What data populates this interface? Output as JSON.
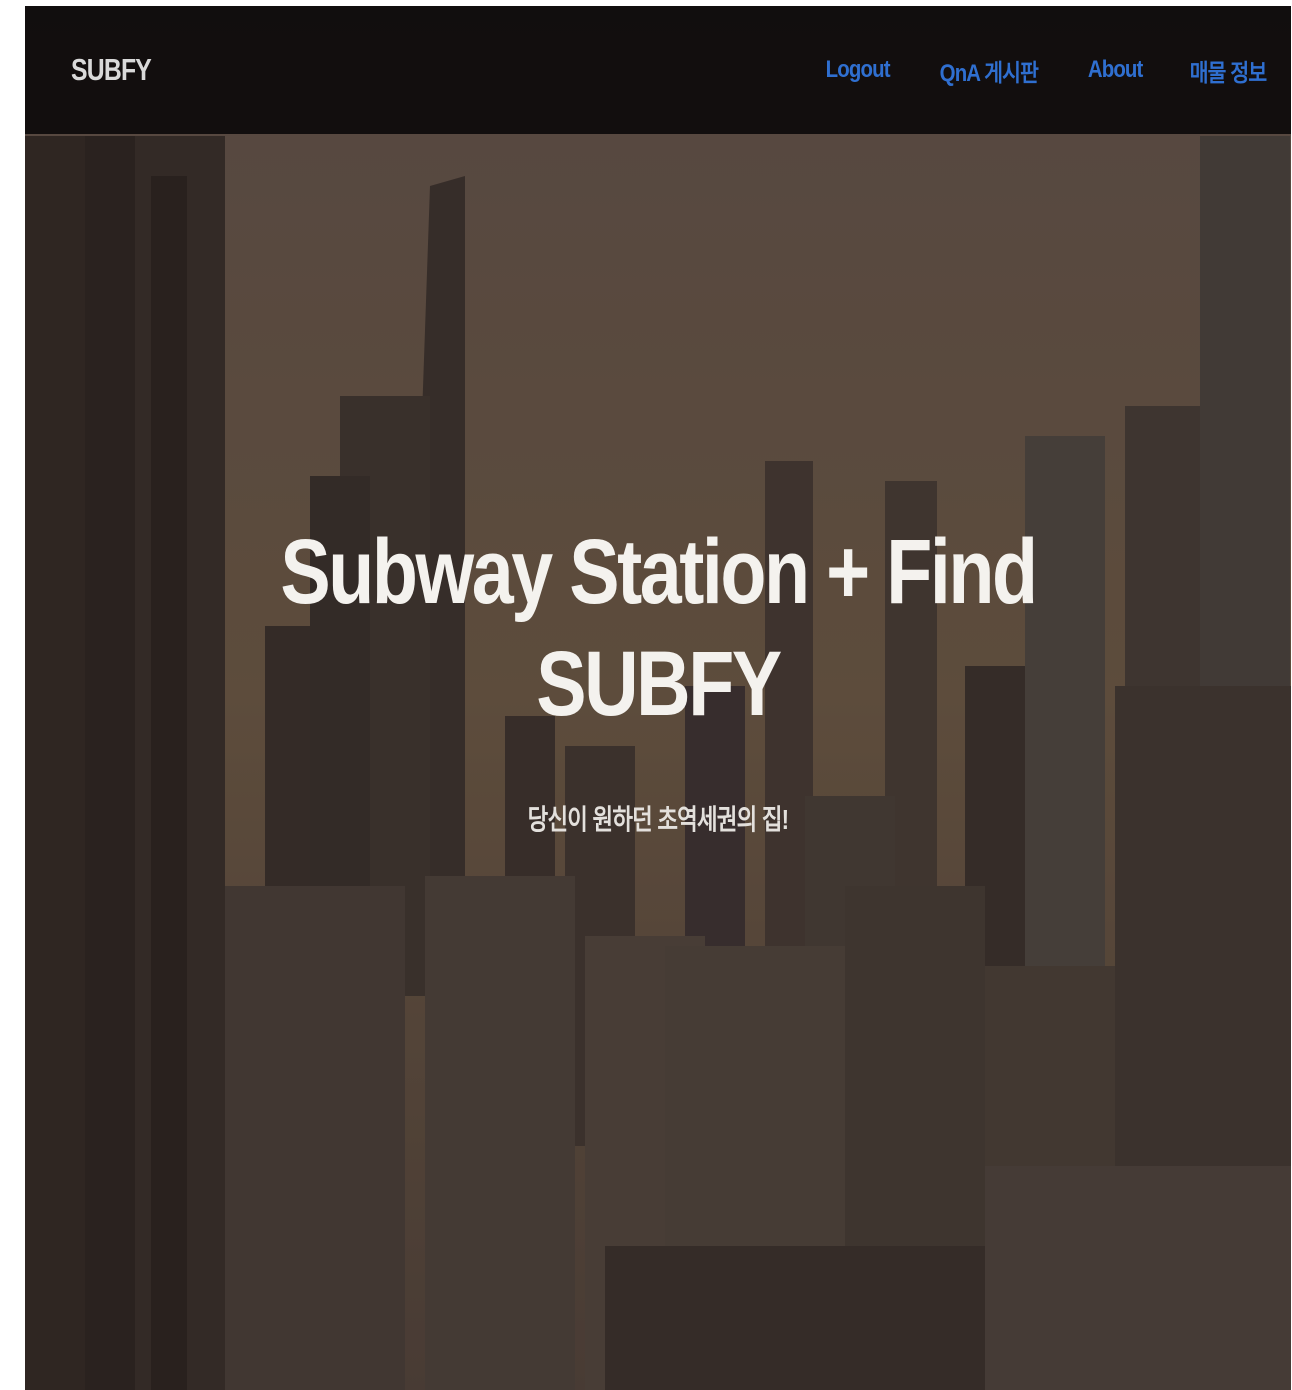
{
  "navbar": {
    "brand": "SUBFY",
    "links": [
      {
        "label": "Logout"
      },
      {
        "label": "QnA 게시판"
      },
      {
        "label": "About"
      },
      {
        "label": "매물 정보"
      }
    ],
    "link_color": "#2f6fd0",
    "background": "#0c0a0a"
  },
  "hero": {
    "title_line1": "Subway Station + Find",
    "title_line2": "SUBFY",
    "subtitle": "당신이 원하던 초역세권의 집!",
    "background_image": "city-skyline-image"
  }
}
